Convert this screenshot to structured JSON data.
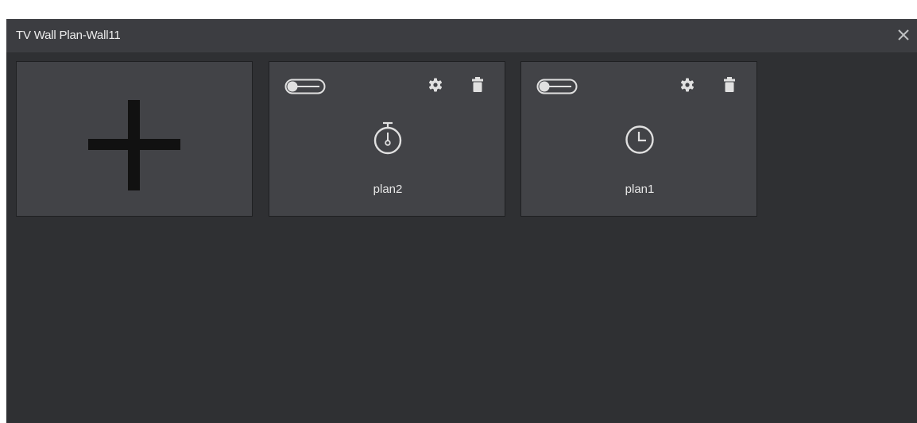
{
  "dialog": {
    "title": "TV Wall Plan-Wall11",
    "close_icon": "close-icon"
  },
  "add_card": {
    "icon": "plus-icon"
  },
  "plans": [
    {
      "name": "plan2",
      "icon": "stopwatch-icon",
      "enabled": false
    },
    {
      "name": "plan1",
      "icon": "clock-icon",
      "enabled": false
    }
  ],
  "colors": {
    "dialog_bg": "#2f3033",
    "titlebar_bg": "#3c3d41",
    "card_bg": "#424347",
    "icon_light": "#e0e0e0",
    "plus_dark": "#111111"
  }
}
